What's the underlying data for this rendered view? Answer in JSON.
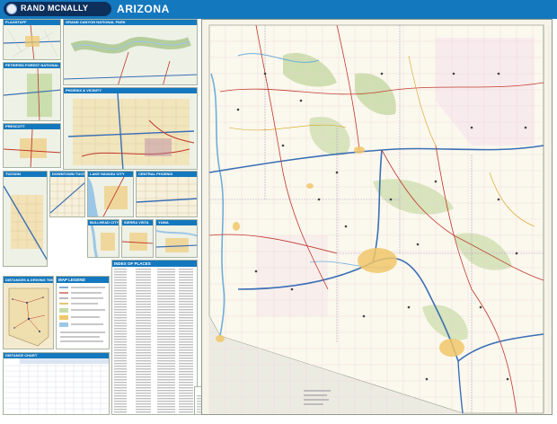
{
  "header": {
    "brand": "RAND MCNALLY",
    "state": "ARIZONA",
    "band_color": "#1478be"
  },
  "insets": [
    {
      "id": "flagstaff",
      "title": "FLAGSTAFF"
    },
    {
      "id": "grand-canyon",
      "title": "GRAND CANYON NATIONAL PARK"
    },
    {
      "id": "petrified-forest",
      "title": "PETRIFIED FOREST NATIONAL PARK"
    },
    {
      "id": "phoenix",
      "title": "PHOENIX & VICINITY"
    },
    {
      "id": "prescott",
      "title": "PRESCOTT"
    },
    {
      "id": "tucson",
      "title": "TUCSON"
    },
    {
      "id": "downtown-tucson",
      "title": "DOWNTOWN TUCSON"
    },
    {
      "id": "lake-havasu",
      "title": "LAKE HAVASU CITY"
    },
    {
      "id": "central-phoenix",
      "title": "CENTRAL PHOENIX"
    },
    {
      "id": "bullhead",
      "title": "BULLHEAD CITY"
    },
    {
      "id": "sierra-vista",
      "title": "SIERRA VISTA"
    },
    {
      "id": "yuma",
      "title": "YUMA"
    }
  ],
  "panels": {
    "distances_map_title": "DISTANCES & DRIVING TIMES MAP",
    "legend_title": "MAP LEGEND",
    "index_title": "INDEX OF PLACES",
    "distance_chart_title": "DISTANCE CHART"
  },
  "colors": {
    "land": "#f6f3e9",
    "forest": "#c7dba6",
    "interstate": "#3b6fb5",
    "highway": "#c0392b",
    "urban": "#f0c76a",
    "water": "#9cc7e6"
  }
}
